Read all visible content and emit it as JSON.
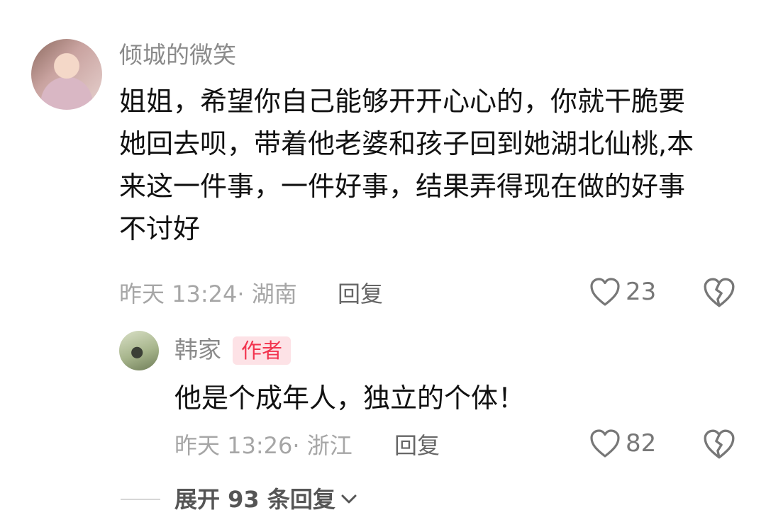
{
  "main_comment": {
    "username": "倾城的微笑",
    "lines": [
      "姐姐，希望你自己能够开开心心的，你就干脆要",
      "她回去呗，带着他老婆和孩子回到她湖北仙桃,本",
      "来这一件事，一件好事，结果弄得现在做的好事",
      "不讨好"
    ],
    "meta": "昨天 13:24· 湖南",
    "reply_label": "回复",
    "likes": "23"
  },
  "reply_comment": {
    "username": "韩家",
    "badge": "作者",
    "text": "他是个成年人，独立的个体！",
    "meta": "昨天 13:26· 浙江",
    "reply_label": "回复",
    "likes": "82"
  },
  "expand_label": "展开 93 条回复",
  "icons": {
    "like": "heart-outline-icon",
    "dislike": "broken-heart-icon",
    "expand": "chevron-down-icon"
  },
  "colors": {
    "badge_text": "#f2334e",
    "badge_bg": "#fde2e6",
    "meta": "#a6a6a6",
    "text": "#111111"
  }
}
